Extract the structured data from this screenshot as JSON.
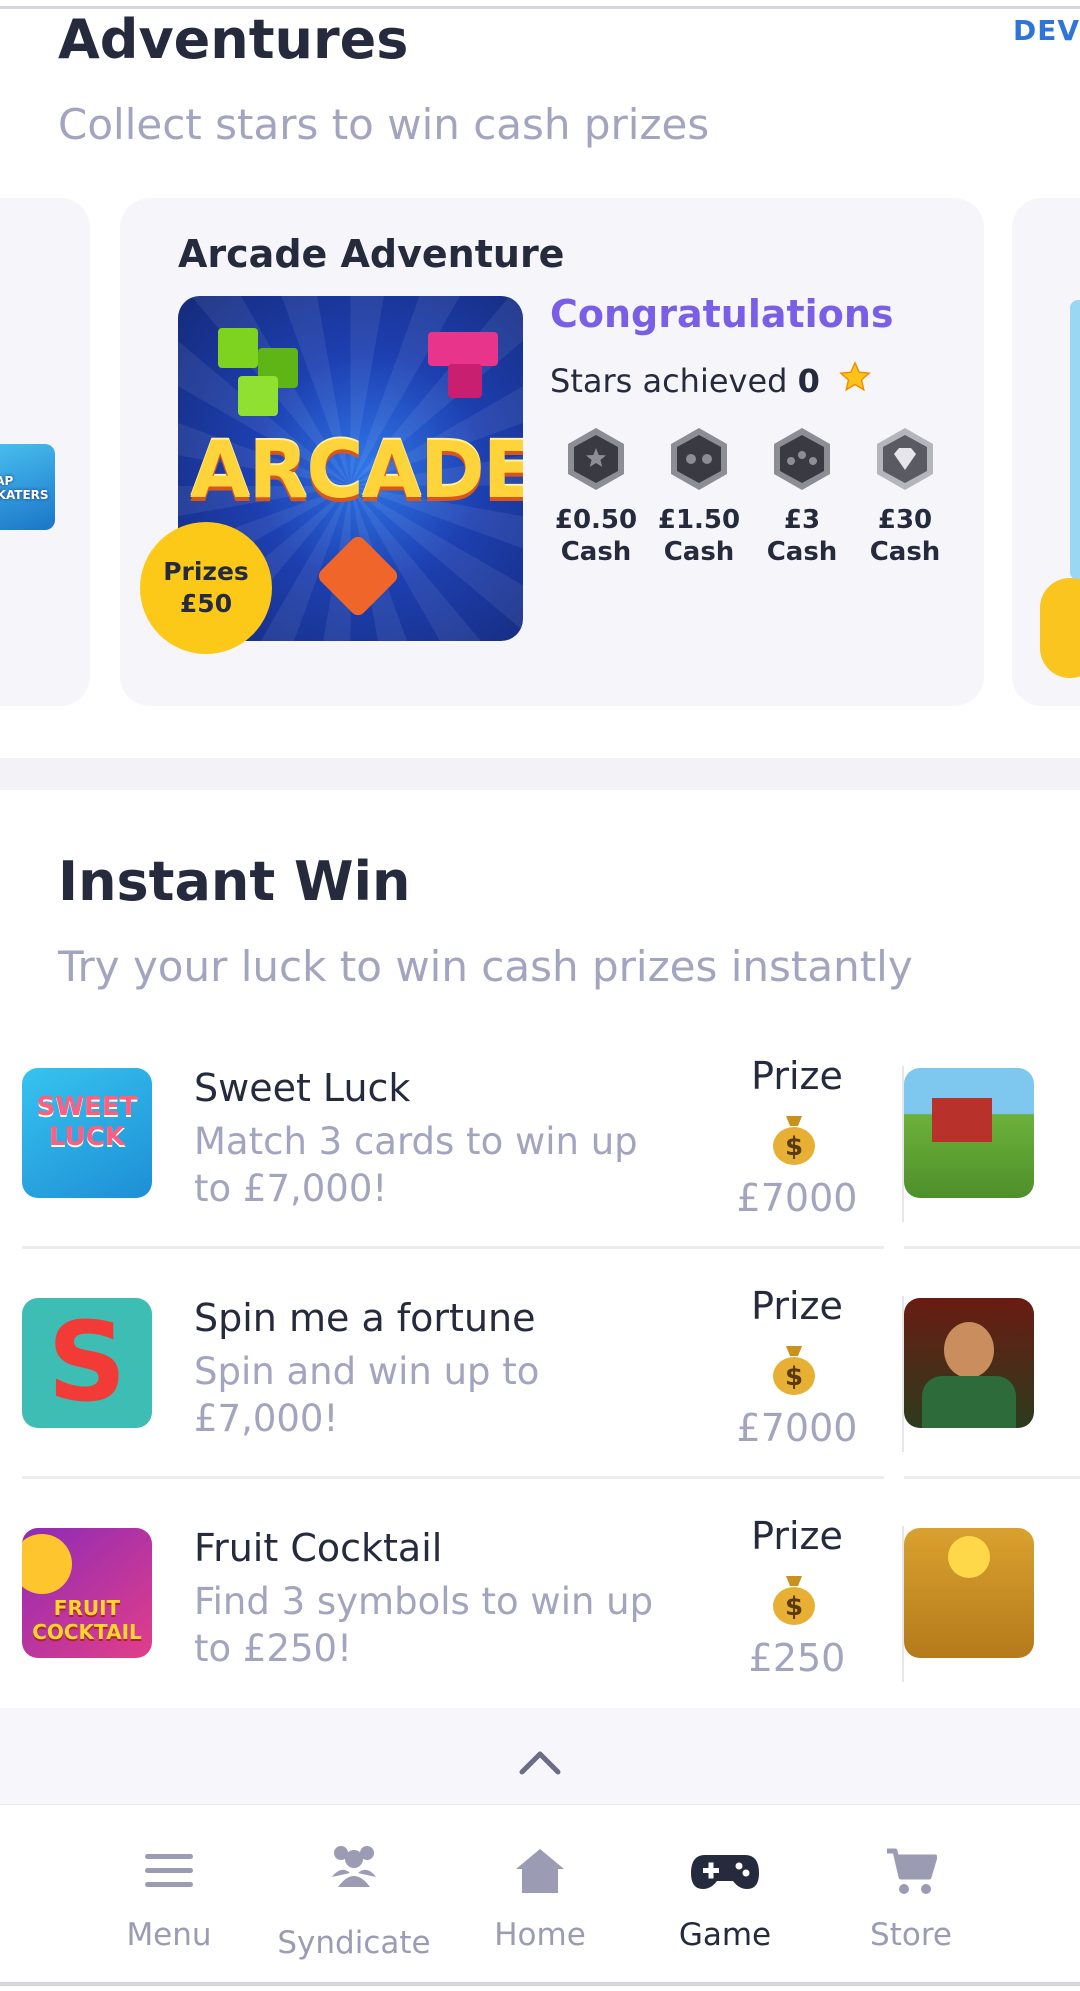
{
  "dev_badge": "DEV",
  "adventures": {
    "title": "Adventures",
    "subtitle": "Collect stars to win cash prizes",
    "card": {
      "title": "Arcade Adventure",
      "art_text": "ARCADE",
      "prize_badge_line1": "Prizes",
      "prize_badge_line2": "£50",
      "status": "Congratulations",
      "stars_label": "Stars achieved",
      "stars_value": "0",
      "tiers": [
        {
          "amount": "£0.50",
          "unit": "Cash"
        },
        {
          "amount": "£1.50",
          "unit": "Cash"
        },
        {
          "amount": "£3",
          "unit": "Cash"
        },
        {
          "amount": "£30",
          "unit": "Cash"
        }
      ]
    },
    "left_peek_text": "TAP SKATERS"
  },
  "instant": {
    "title": "Instant Win",
    "subtitle": "Try your luck to win cash prizes instantly",
    "games": [
      {
        "name": "Sweet Luck",
        "desc": "Match 3 cards to win up to £7,000!",
        "prize_label": "Prize",
        "prize": "£7000",
        "art_text": "SWEET LUCK"
      },
      {
        "name": "Spin me a fortune",
        "desc": "Spin and win up to £7,000!",
        "prize_label": "Prize",
        "prize": "£7000",
        "art_text": "S"
      },
      {
        "name": "Fruit Cocktail",
        "desc": "Find 3 symbols to win up to £250!",
        "prize_label": "Prize",
        "prize": "£250",
        "art_text": "FRUIT COCKTAIL"
      }
    ]
  },
  "nav": {
    "items": [
      {
        "label": "Menu",
        "icon": "menu-icon"
      },
      {
        "label": "Syndicate",
        "icon": "group-icon"
      },
      {
        "label": "Home",
        "icon": "home-icon"
      },
      {
        "label": "Game",
        "icon": "gamepad-icon",
        "active": true
      },
      {
        "label": "Store",
        "icon": "cart-icon"
      }
    ]
  },
  "colors": {
    "accent": "#7a5fe6",
    "text": "#262a3d",
    "muted": "#a3a4bf",
    "badge": "#fcc919",
    "dev": "#2f74d8"
  }
}
